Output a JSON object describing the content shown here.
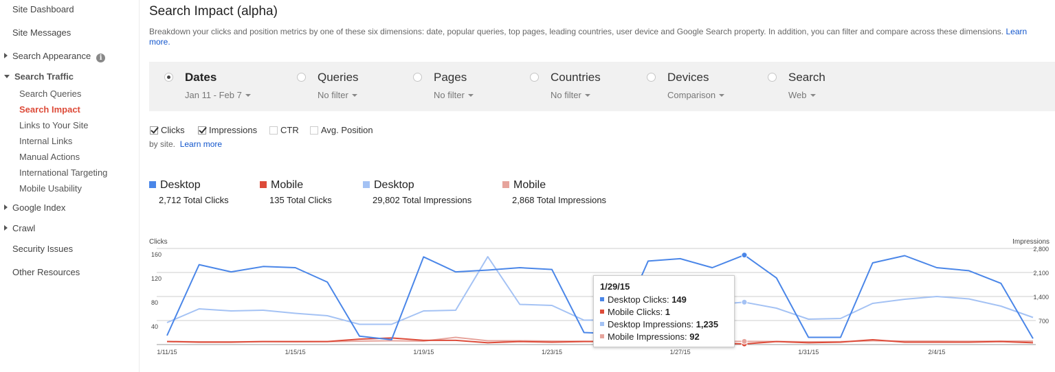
{
  "sidebar": {
    "site_dashboard": "Site Dashboard",
    "site_messages": "Site Messages",
    "search_appearance": "Search Appearance",
    "search_traffic": "Search Traffic",
    "sub": [
      "Search Queries",
      "Search Impact",
      "Links to Your Site",
      "Internal Links",
      "Manual Actions",
      "International Targeting",
      "Mobile Usability"
    ],
    "google_index": "Google Index",
    "crawl": "Crawl",
    "security_issues": "Security Issues",
    "other_resources": "Other Resources",
    "info_glyph": "i"
  },
  "main": {
    "title": "Search Impact (alpha)",
    "description": "Breakdown your clicks and position metrics by one of these six dimensions: date, popular queries, top pages, leading countries, user device and Google Search property. In addition, you can filter and compare across these dimensions.",
    "learn_more": "Learn more.",
    "by_site": "by site.",
    "learn_more_2": "Learn more"
  },
  "dimensions": [
    {
      "label": "Dates",
      "filter": "Jan 11 - Feb 7",
      "selected": true
    },
    {
      "label": "Queries",
      "filter": "No filter",
      "selected": false
    },
    {
      "label": "Pages",
      "filter": "No filter",
      "selected": false
    },
    {
      "label": "Countries",
      "filter": "No filter",
      "selected": false
    },
    {
      "label": "Devices",
      "filter": "Comparison",
      "selected": false
    },
    {
      "label": "Search",
      "filter": "Web",
      "selected": false
    }
  ],
  "metrics": [
    {
      "label": "Clicks",
      "checked": true
    },
    {
      "label": "Impressions",
      "checked": true
    },
    {
      "label": "CTR",
      "checked": false
    },
    {
      "label": "Avg. Position",
      "checked": false
    }
  ],
  "legend": [
    {
      "name": "Desktop",
      "total": "2,712 Total Clicks",
      "color": "#4a86e8"
    },
    {
      "name": "Mobile",
      "total": "135 Total Clicks",
      "color": "#dd4b39"
    },
    {
      "name": "Desktop",
      "total": "29,802 Total Impressions",
      "color": "#a4c2f4"
    },
    {
      "name": "Mobile",
      "total": "2,868 Total Impressions",
      "color": "#e6a49c"
    }
  ],
  "tooltip": {
    "date": "1/29/15",
    "rows": [
      {
        "label": "Desktop Clicks: ",
        "value": "149",
        "color": "#4a86e8"
      },
      {
        "label": "Mobile Clicks: ",
        "value": "1",
        "color": "#dd4b39"
      },
      {
        "label": "Desktop Impressions: ",
        "value": "1,235",
        "color": "#a4c2f4"
      },
      {
        "label": "Mobile Impressions: ",
        "value": "92",
        "color": "#e6a49c"
      }
    ]
  },
  "chart_data": {
    "type": "line",
    "ylabel_left": "Clicks",
    "ylabel_right": "Impressions",
    "y_left_ticks": [
      "40",
      "80",
      "120",
      "160"
    ],
    "y_right_ticks": [
      "700",
      "1,400",
      "2,100",
      "2,800"
    ],
    "ylim_left": [
      0,
      160
    ],
    "ylim_right": [
      0,
      2800
    ],
    "x_ticks": [
      "1/11/15",
      "1/15/15",
      "1/19/15",
      "1/23/15",
      "1/27/15",
      "1/31/15",
      "2/4/15"
    ],
    "x": [
      "1/11/15",
      "1/12/15",
      "1/13/15",
      "1/14/15",
      "1/15/15",
      "1/16/15",
      "1/17/15",
      "1/18/15",
      "1/19/15",
      "1/20/15",
      "1/21/15",
      "1/22/15",
      "1/23/15",
      "1/24/15",
      "1/25/15",
      "1/26/15",
      "1/27/15",
      "1/28/15",
      "1/29/15",
      "1/30/15",
      "1/31/15",
      "2/1/15",
      "2/2/15",
      "2/3/15",
      "2/4/15",
      "2/5/15",
      "2/6/15",
      "2/7/15"
    ],
    "series": [
      {
        "name": "Desktop Clicks",
        "axis": "left",
        "color": "#4a86e8",
        "values": [
          15,
          133,
          121,
          130,
          128,
          104,
          14,
          8,
          146,
          121,
          124,
          128,
          125,
          20,
          18,
          139,
          143,
          128,
          149,
          111,
          12,
          12,
          136,
          148,
          128,
          123,
          102,
          10
        ]
      },
      {
        "name": "Mobile Clicks",
        "axis": "left",
        "color": "#dd4b39",
        "values": [
          5,
          4,
          4,
          5,
          5,
          5,
          9,
          11,
          7,
          7,
          3,
          5,
          4,
          5,
          5,
          6,
          4,
          3,
          1,
          5,
          3,
          4,
          8,
          4,
          4,
          4,
          5,
          3
        ]
      },
      {
        "name": "Desktop Impressions",
        "axis": "left_unit_right",
        "color": "#a4c2f4",
        "values": [
          640,
          1040,
          980,
          1000,
          910,
          840,
          590,
          590,
          980,
          1000,
          2560,
          1170,
          1140,
          710,
          720,
          1180,
          1210,
          1160,
          1235,
          1060,
          740,
          760,
          1200,
          1320,
          1400,
          1330,
          1120,
          790
        ]
      },
      {
        "name": "Mobile Impressions",
        "axis": "right",
        "color": "#e6a49c",
        "values": [
          90,
          80,
          80,
          85,
          80,
          85,
          100,
          110,
          100,
          210,
          110,
          110,
          100,
          95,
          90,
          100,
          95,
          95,
          92,
          90,
          80,
          85,
          110,
          100,
          100,
          95,
          100,
          100
        ]
      }
    ],
    "highlight_index": 18,
    "grid": true,
    "legend": "top-left"
  }
}
